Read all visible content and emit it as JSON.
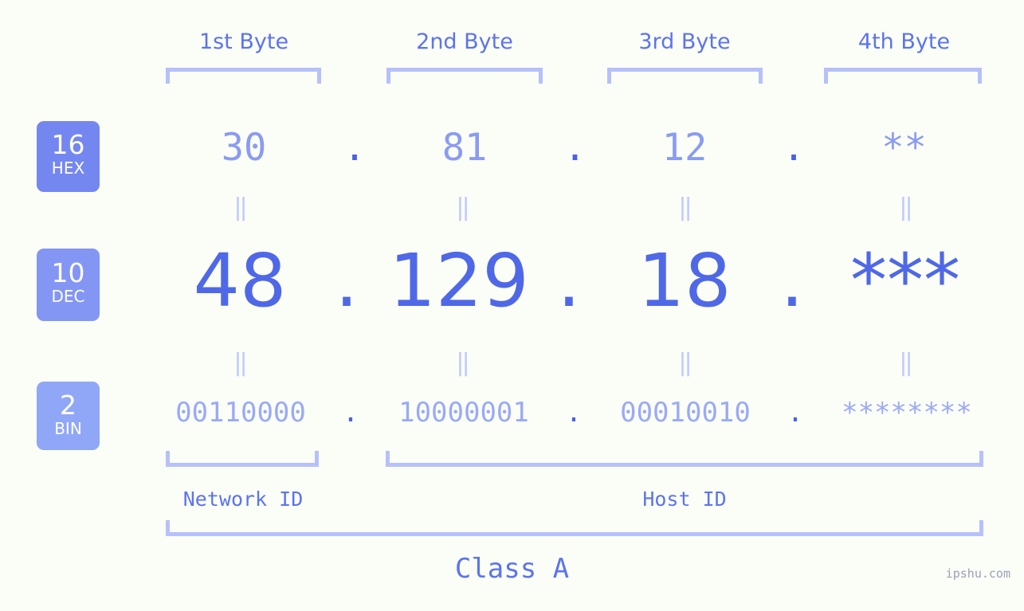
{
  "background_color": "#fbfdf7",
  "accent_color": "#4f68e8",
  "accent_light": "#8a9bf3",
  "bracket_color": "#b6c0fb",
  "headers": [
    {
      "label": "1st Byte"
    },
    {
      "label": "2nd Byte"
    },
    {
      "label": "3rd Byte"
    },
    {
      "label": "4th Byte"
    }
  ],
  "bases": [
    {
      "number": "16",
      "name": "HEX",
      "color": "#7487f0"
    },
    {
      "number": "10",
      "name": "DEC",
      "color": "#8396f4"
    },
    {
      "number": "2",
      "name": "BIN",
      "color": "#90a7f8"
    }
  ],
  "rows": {
    "hex": {
      "base_number": "16",
      "base_name": "HEX",
      "values": [
        "30",
        "81",
        "12",
        "**"
      ],
      "separator": "."
    },
    "dec": {
      "base_number": "10",
      "base_name": "DEC",
      "values": [
        "48",
        "129",
        "18",
        "***"
      ],
      "separator": "."
    },
    "bin": {
      "base_number": "2",
      "base_name": "BIN",
      "values": [
        "00110000",
        "10000001",
        "00010010",
        "********"
      ],
      "separator": "."
    }
  },
  "equality_marks": {
    "glyph": "‖",
    "hex_to_dec_count": 4,
    "dec_to_bin_count": 4
  },
  "segments": {
    "network_id": "Network ID",
    "host_id": "Host ID"
  },
  "class_label": "Class A",
  "watermark": "ipshu.com"
}
